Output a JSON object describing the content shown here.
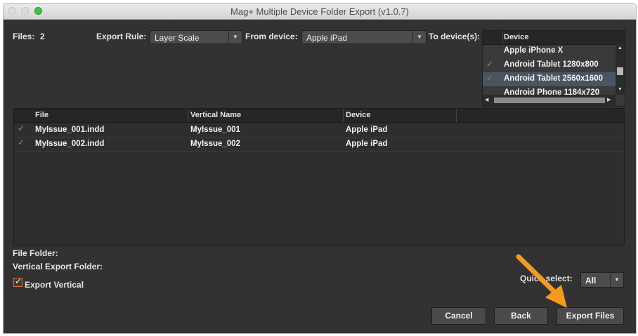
{
  "window": {
    "title": "Mag+ Multiple Device Folder Export (v1.0.7)"
  },
  "files": {
    "label": "Files:",
    "count": "2"
  },
  "export_rule": {
    "label": "Export Rule:",
    "value": "Layer Scale"
  },
  "from_device": {
    "label": "From device:",
    "value": "Apple iPad"
  },
  "to_devices": {
    "label": "To device(s):",
    "column_header": "Device",
    "items": [
      {
        "name": "Apple iPhone X",
        "checked": false,
        "selected": false
      },
      {
        "name": "Android Tablet 1280x800",
        "checked": true,
        "selected": false
      },
      {
        "name": "Android Tablet 2560x1600",
        "checked": true,
        "selected": true
      },
      {
        "name": "Android Phone 1184x720",
        "checked": false,
        "selected": false
      }
    ]
  },
  "file_table": {
    "headers": [
      "File",
      "Vertical Name",
      "Device"
    ],
    "rows": [
      {
        "file": "MyIssue_001.indd",
        "vertical_name": "MyIssue_001",
        "device": "Apple iPad",
        "checked": true
      },
      {
        "file": "MyIssue_002.indd",
        "vertical_name": "MyIssue_002",
        "device": "Apple iPad",
        "checked": true
      }
    ]
  },
  "file_folder": {
    "label": "File Folder:"
  },
  "vertical_export_folder": {
    "label": "Vertical Export Folder:"
  },
  "export_vertical": {
    "label": "Export Vertical",
    "checked": true
  },
  "quick_select": {
    "label": "Quick select:",
    "value": "All"
  },
  "buttons": {
    "cancel": "Cancel",
    "back": "Back",
    "export_files": "Export Files"
  },
  "colors": {
    "background": "#323232",
    "selection": "#4a5463",
    "checkbox_accent": "#e8732a",
    "annotation_arrow": "#f39a1f"
  },
  "icons": {
    "checkmark": "check-icon",
    "dropdown": "chevron-down-icon",
    "annotation": "arrow-annotation-icon"
  }
}
